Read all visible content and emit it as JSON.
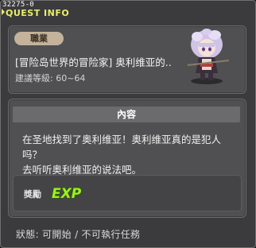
{
  "window": {
    "id": "32275-0",
    "title": "QUEST INFO"
  },
  "quest": {
    "job_label": "職業",
    "name": "[冒险岛世界的冒险家] 奥利维亚的..",
    "level": "建議等級: 60~64"
  },
  "content": {
    "header": "內容",
    "description_line1": "在圣地找到了奥利维亚！奥利维亚真的是犯人吗？",
    "description_line2": "去听听奥利维亚的说法吧。"
  },
  "reward": {
    "label": "獎勵",
    "icon": "exp-icon",
    "icon_text": "EXP"
  },
  "status": "狀態: 可開始 / 不可執行任務",
  "colors": {
    "title": "#e8f069",
    "exp": "#9cf020",
    "badge": "#c4b29b"
  }
}
